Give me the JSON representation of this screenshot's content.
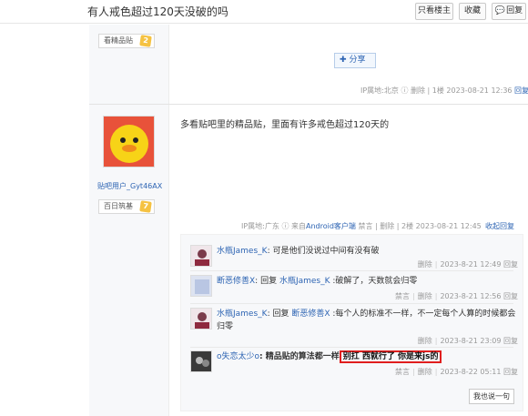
{
  "header": {
    "title": "有人戒色超过120天没破的吗",
    "btn_louzhu": "只看楼主",
    "btn_fav": "收藏",
    "btn_reply": "回复"
  },
  "post1": {
    "badge_label": "看精品贴",
    "badge_level": "2",
    "share_label": "分享",
    "ip": "IP属地:北京",
    "delete": "删除",
    "floor": "1楼",
    "time": "2023-08-21 12:36",
    "reply": "回复"
  },
  "post2": {
    "username": "贴吧用户_Gyt46AX",
    "badge_label": "百日筑基",
    "badge_level": "7",
    "content": "多看贴吧里的精品贴，里面有许多戒色超过120天的",
    "ip": "IP属地:广东",
    "source_prefix": "来自",
    "source_app": "Android客户端",
    "jinyan": "禁言",
    "delete": "删除",
    "floor": "2楼",
    "time": "2023-08-21 12:45",
    "collapse": "收起回复"
  },
  "comments": [
    {
      "nick": "水瓶James_K",
      "text": ": 可是他们没说过中间有没有破",
      "actions": "删除",
      "time": "2023-8-21 12:49",
      "reply": "回复"
    },
    {
      "nick": "断恶修善X",
      "reply_word": ": 回复",
      "target": "水瓶James_K",
      "text": " :破解了，天数就会归零",
      "jinyan": "禁言",
      "actions": "删除",
      "time": "2023-8-21 12:56",
      "reply": "回复"
    },
    {
      "nick": "水瓶James_K",
      "reply_word": ": 回复",
      "target": "断恶修善X",
      "text": " :每个人的标准不一样，不一定每个人算的时候都会归零",
      "actions": "删除",
      "time": "2023-8-21 23:09",
      "reply": "回复"
    },
    {
      "nick": "o失恋太少o",
      "text_bold": ": 精品贴的算法都一样",
      "highlight": "别扛 西就行了 你是来js的",
      "jinyan": "禁言",
      "actions": "删除",
      "time": "2023-8-22 05:11",
      "reply": "回复"
    }
  ],
  "say_button": "我也说一句",
  "icons": [
    "reply-icon",
    "plus-icon",
    "help-icon",
    "avatar-duck",
    "level-badge-icon"
  ],
  "colors": {
    "link": "#2d64b3",
    "highlight_border": "#e01e1e",
    "badge": "#f5c242"
  }
}
